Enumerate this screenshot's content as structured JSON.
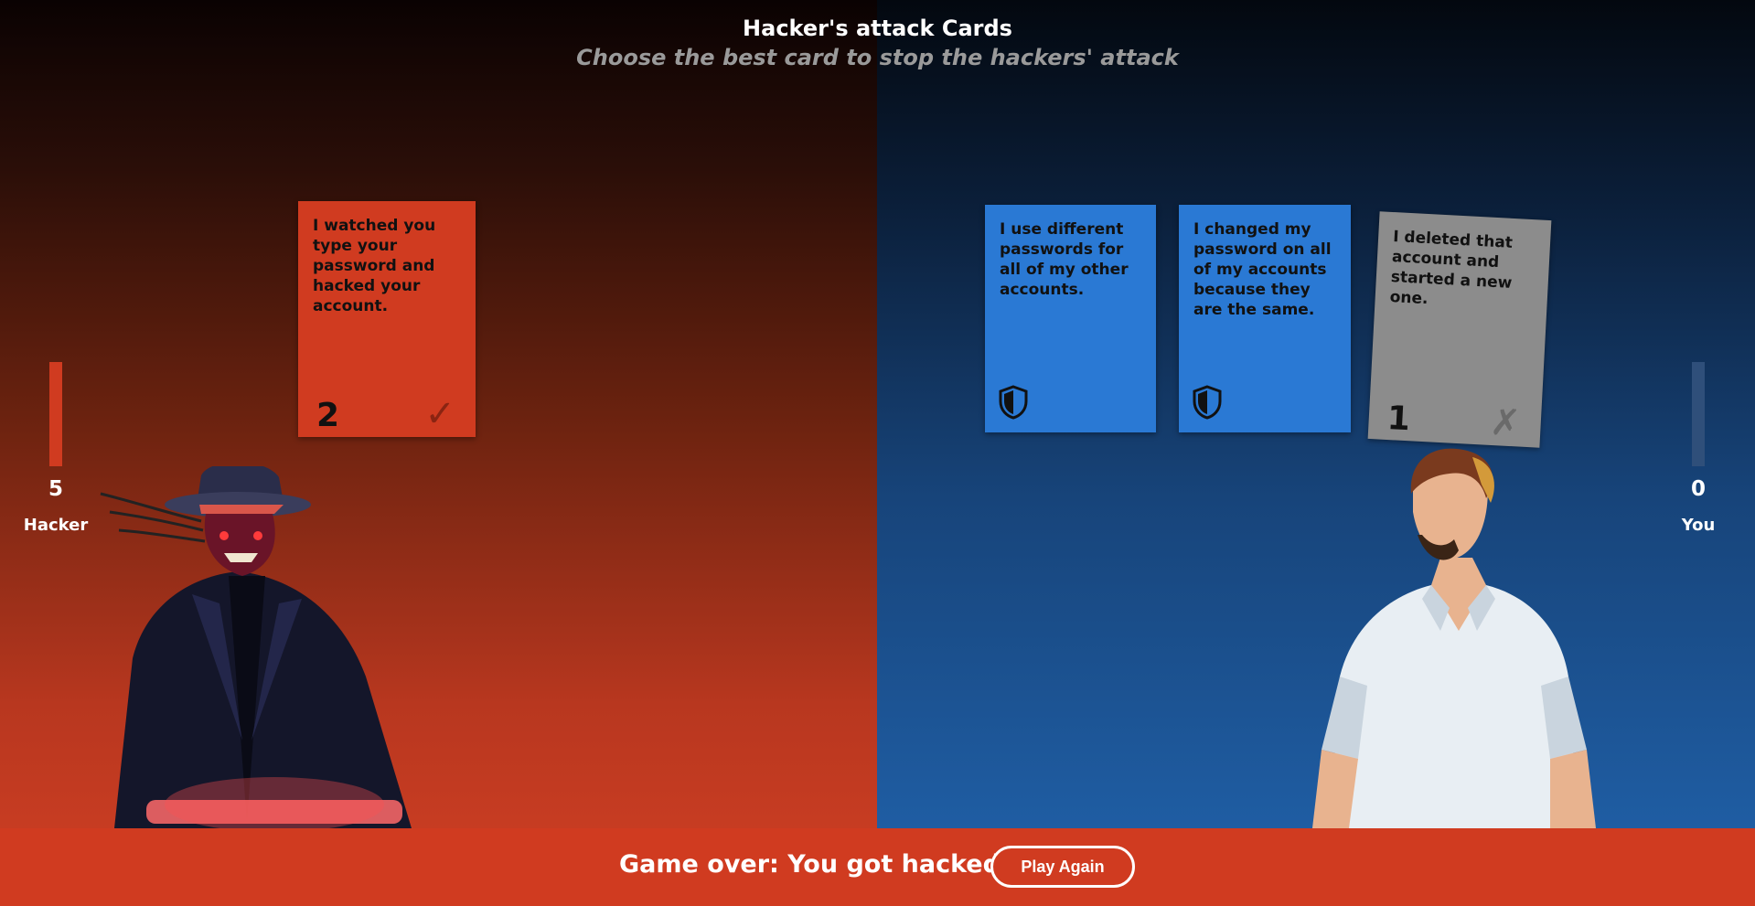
{
  "header": {
    "title": "Hacker's attack Cards",
    "subtitle": "Choose the best card to stop the hackers' attack"
  },
  "hacker": {
    "score": "5",
    "label": "Hacker",
    "meter_color": "#d03b20"
  },
  "player": {
    "score": "0",
    "label": "You",
    "meter_color": "#2f4f7a"
  },
  "attack_card": {
    "text": "I watched you type your password and hacked your account.",
    "value": "2",
    "mark": "✓",
    "color": "#d03b20"
  },
  "defense_cards": [
    {
      "text": "I use different passwords for all of my other accounts.",
      "icon": "shield-icon",
      "color": "#2a79d4"
    },
    {
      "text": "I changed my password on all of my accounts because they are the same.",
      "icon": "shield-icon",
      "color": "#2a79d4"
    }
  ],
  "played_card": {
    "text": "I deleted that account and started a new one.",
    "value": "1",
    "mark": "✗",
    "color": "#8c8c8c"
  },
  "footer": {
    "message": "Game over: You got hacked!",
    "play_again_label": "Play Again",
    "color": "#d03b20"
  }
}
